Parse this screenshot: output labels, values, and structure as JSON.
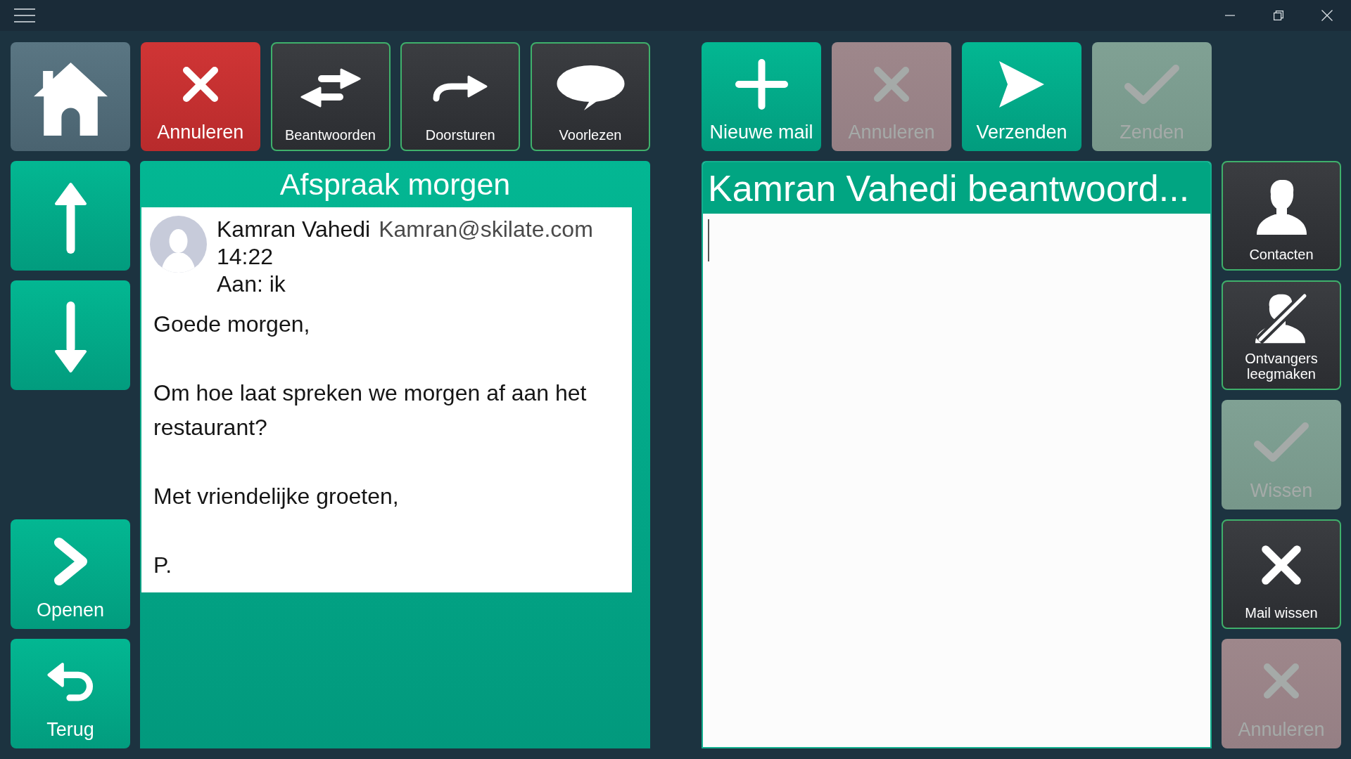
{
  "toolbar_left": [
    {
      "kind": "home",
      "disabled": false
    },
    {
      "kind": "cancel",
      "label": "Annuleren",
      "disabled": false
    },
    {
      "kind": "reply",
      "label": "Beantwoorden",
      "disabled": false
    },
    {
      "kind": "forward",
      "label": "Doorsturen",
      "disabled": false
    },
    {
      "kind": "speak",
      "label": "Voorlezen",
      "disabled": false
    }
  ],
  "toolbar_right": [
    {
      "kind": "new",
      "label": "Nieuwe mail",
      "disabled": false
    },
    {
      "kind": "cancel",
      "label": "Annuleren",
      "disabled": true
    },
    {
      "kind": "send",
      "label": "Verzenden",
      "disabled": false
    },
    {
      "kind": "confirm",
      "label": "Zenden",
      "disabled": true
    }
  ],
  "navigation": {
    "scroll": [
      {
        "kind": "up",
        "disabled": false
      },
      {
        "kind": "down",
        "disabled": false
      }
    ],
    "actions": [
      {
        "kind": "open",
        "label": "Openen",
        "disabled": false
      },
      {
        "kind": "back",
        "label": "Terug",
        "disabled": false
      }
    ]
  },
  "message": {
    "subject": "Afspraak morgen",
    "sender_name": "Kamran Vahedi",
    "sender_email": "Kamran@skilate.com",
    "time": "14:22",
    "recipients": "Aan: ik",
    "body": [
      "Goede morgen,",
      "Om hoe laat spreken we morgen af aan het restaurant?",
      "Met vriendelijke groeten,",
      "P."
    ]
  },
  "reply": {
    "title": "Kamran Vahedi beantwoord..."
  },
  "side_buttons": [
    {
      "kind": "contacts",
      "label": "Contacten",
      "disabled": false
    },
    {
      "kind": "clear",
      "label": "Ontvangers leegmaken",
      "disabled": false
    },
    {
      "kind": "confirm",
      "label": "Wissen",
      "disabled": true
    },
    {
      "kind": "delete",
      "label": "Mail wissen",
      "disabled": false
    },
    {
      "kind": "cancel",
      "label": "Annuleren",
      "disabled": true
    }
  ]
}
